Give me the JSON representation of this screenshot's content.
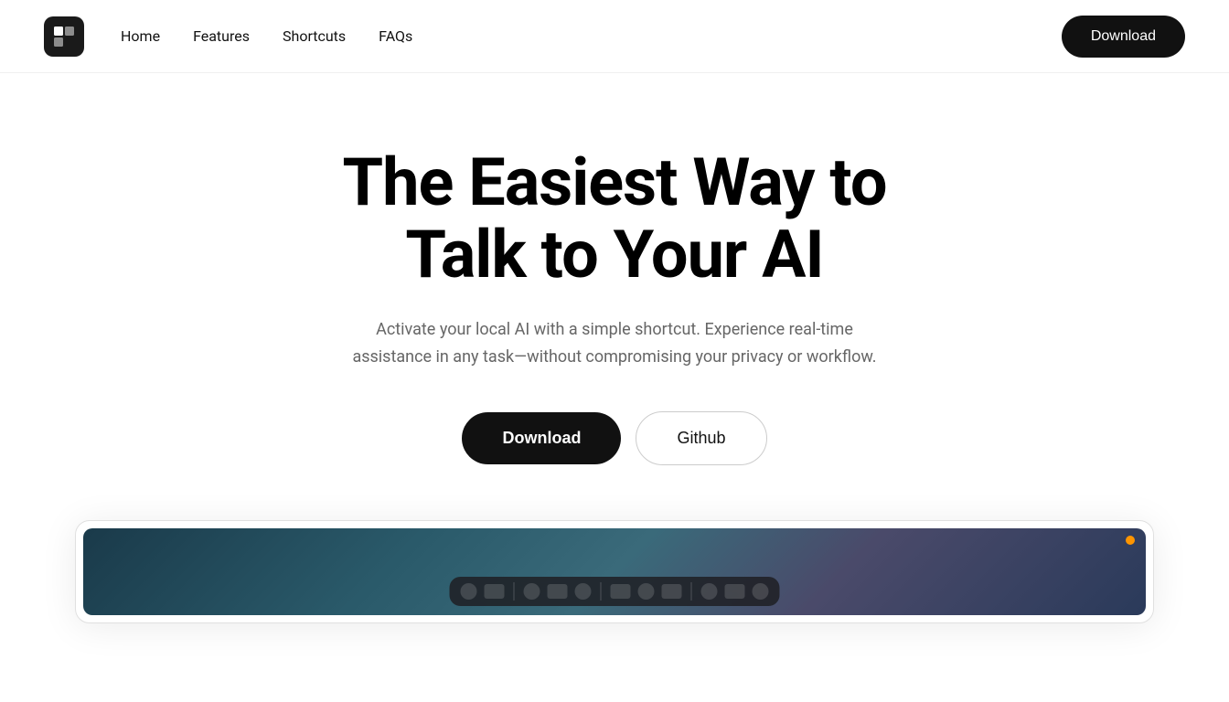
{
  "nav": {
    "logo_alt": "App Logo",
    "links": [
      {
        "label": "Home",
        "id": "home"
      },
      {
        "label": "Features",
        "id": "features"
      },
      {
        "label": "Shortcuts",
        "id": "shortcuts"
      },
      {
        "label": "FAQs",
        "id": "faqs"
      }
    ],
    "download_label": "Download"
  },
  "hero": {
    "title_line1": "The Easiest Way to",
    "title_line2": "Talk to Your AI",
    "subtitle": "Activate your local AI with a simple shortcut. Experience real-time assistance in any task—without compromising your privacy or workflow.",
    "download_label": "Download",
    "github_label": "Github"
  },
  "preview": {
    "alt": "App preview screenshot"
  }
}
